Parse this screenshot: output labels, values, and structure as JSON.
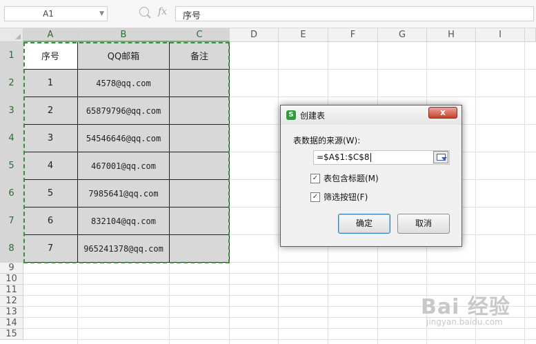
{
  "formula_bar": {
    "name_box": "A1",
    "fx_label": "fx",
    "formula": "序号"
  },
  "columns": [
    "A",
    "B",
    "C",
    "D",
    "E",
    "F",
    "G",
    "H",
    "I"
  ],
  "rows": [
    "1",
    "2",
    "3",
    "4",
    "5",
    "6",
    "7",
    "8",
    "9",
    "10",
    "11",
    "12",
    "13",
    "14",
    "15"
  ],
  "table": {
    "headers": [
      "序号",
      "QQ邮箱",
      "备注"
    ],
    "rows": [
      [
        "1",
        "4578@qq.com",
        ""
      ],
      [
        "2",
        "65879796@qq.com",
        ""
      ],
      [
        "3",
        "54546646@qq.com",
        ""
      ],
      [
        "4",
        "467001@qq.com",
        ""
      ],
      [
        "5",
        "7985641@qq.com",
        ""
      ],
      [
        "6",
        "832104@qq.com",
        ""
      ],
      [
        "7",
        "965241378@qq.com",
        ""
      ]
    ]
  },
  "dialog": {
    "app_icon": "S",
    "title": "创建表",
    "source_label": "表数据的来源(W):",
    "range_value": "=$A$1:$C$8",
    "checkbox_header": "表包含标题(M)",
    "checkbox_header_checked": true,
    "checkbox_filter": "筛选按钮(F)",
    "checkbox_filter_checked": true,
    "ok_label": "确定",
    "cancel_label": "取消",
    "close_label": "x"
  },
  "watermark": {
    "main": "Bai 经验",
    "sub": "jingyan.baidu.com"
  }
}
